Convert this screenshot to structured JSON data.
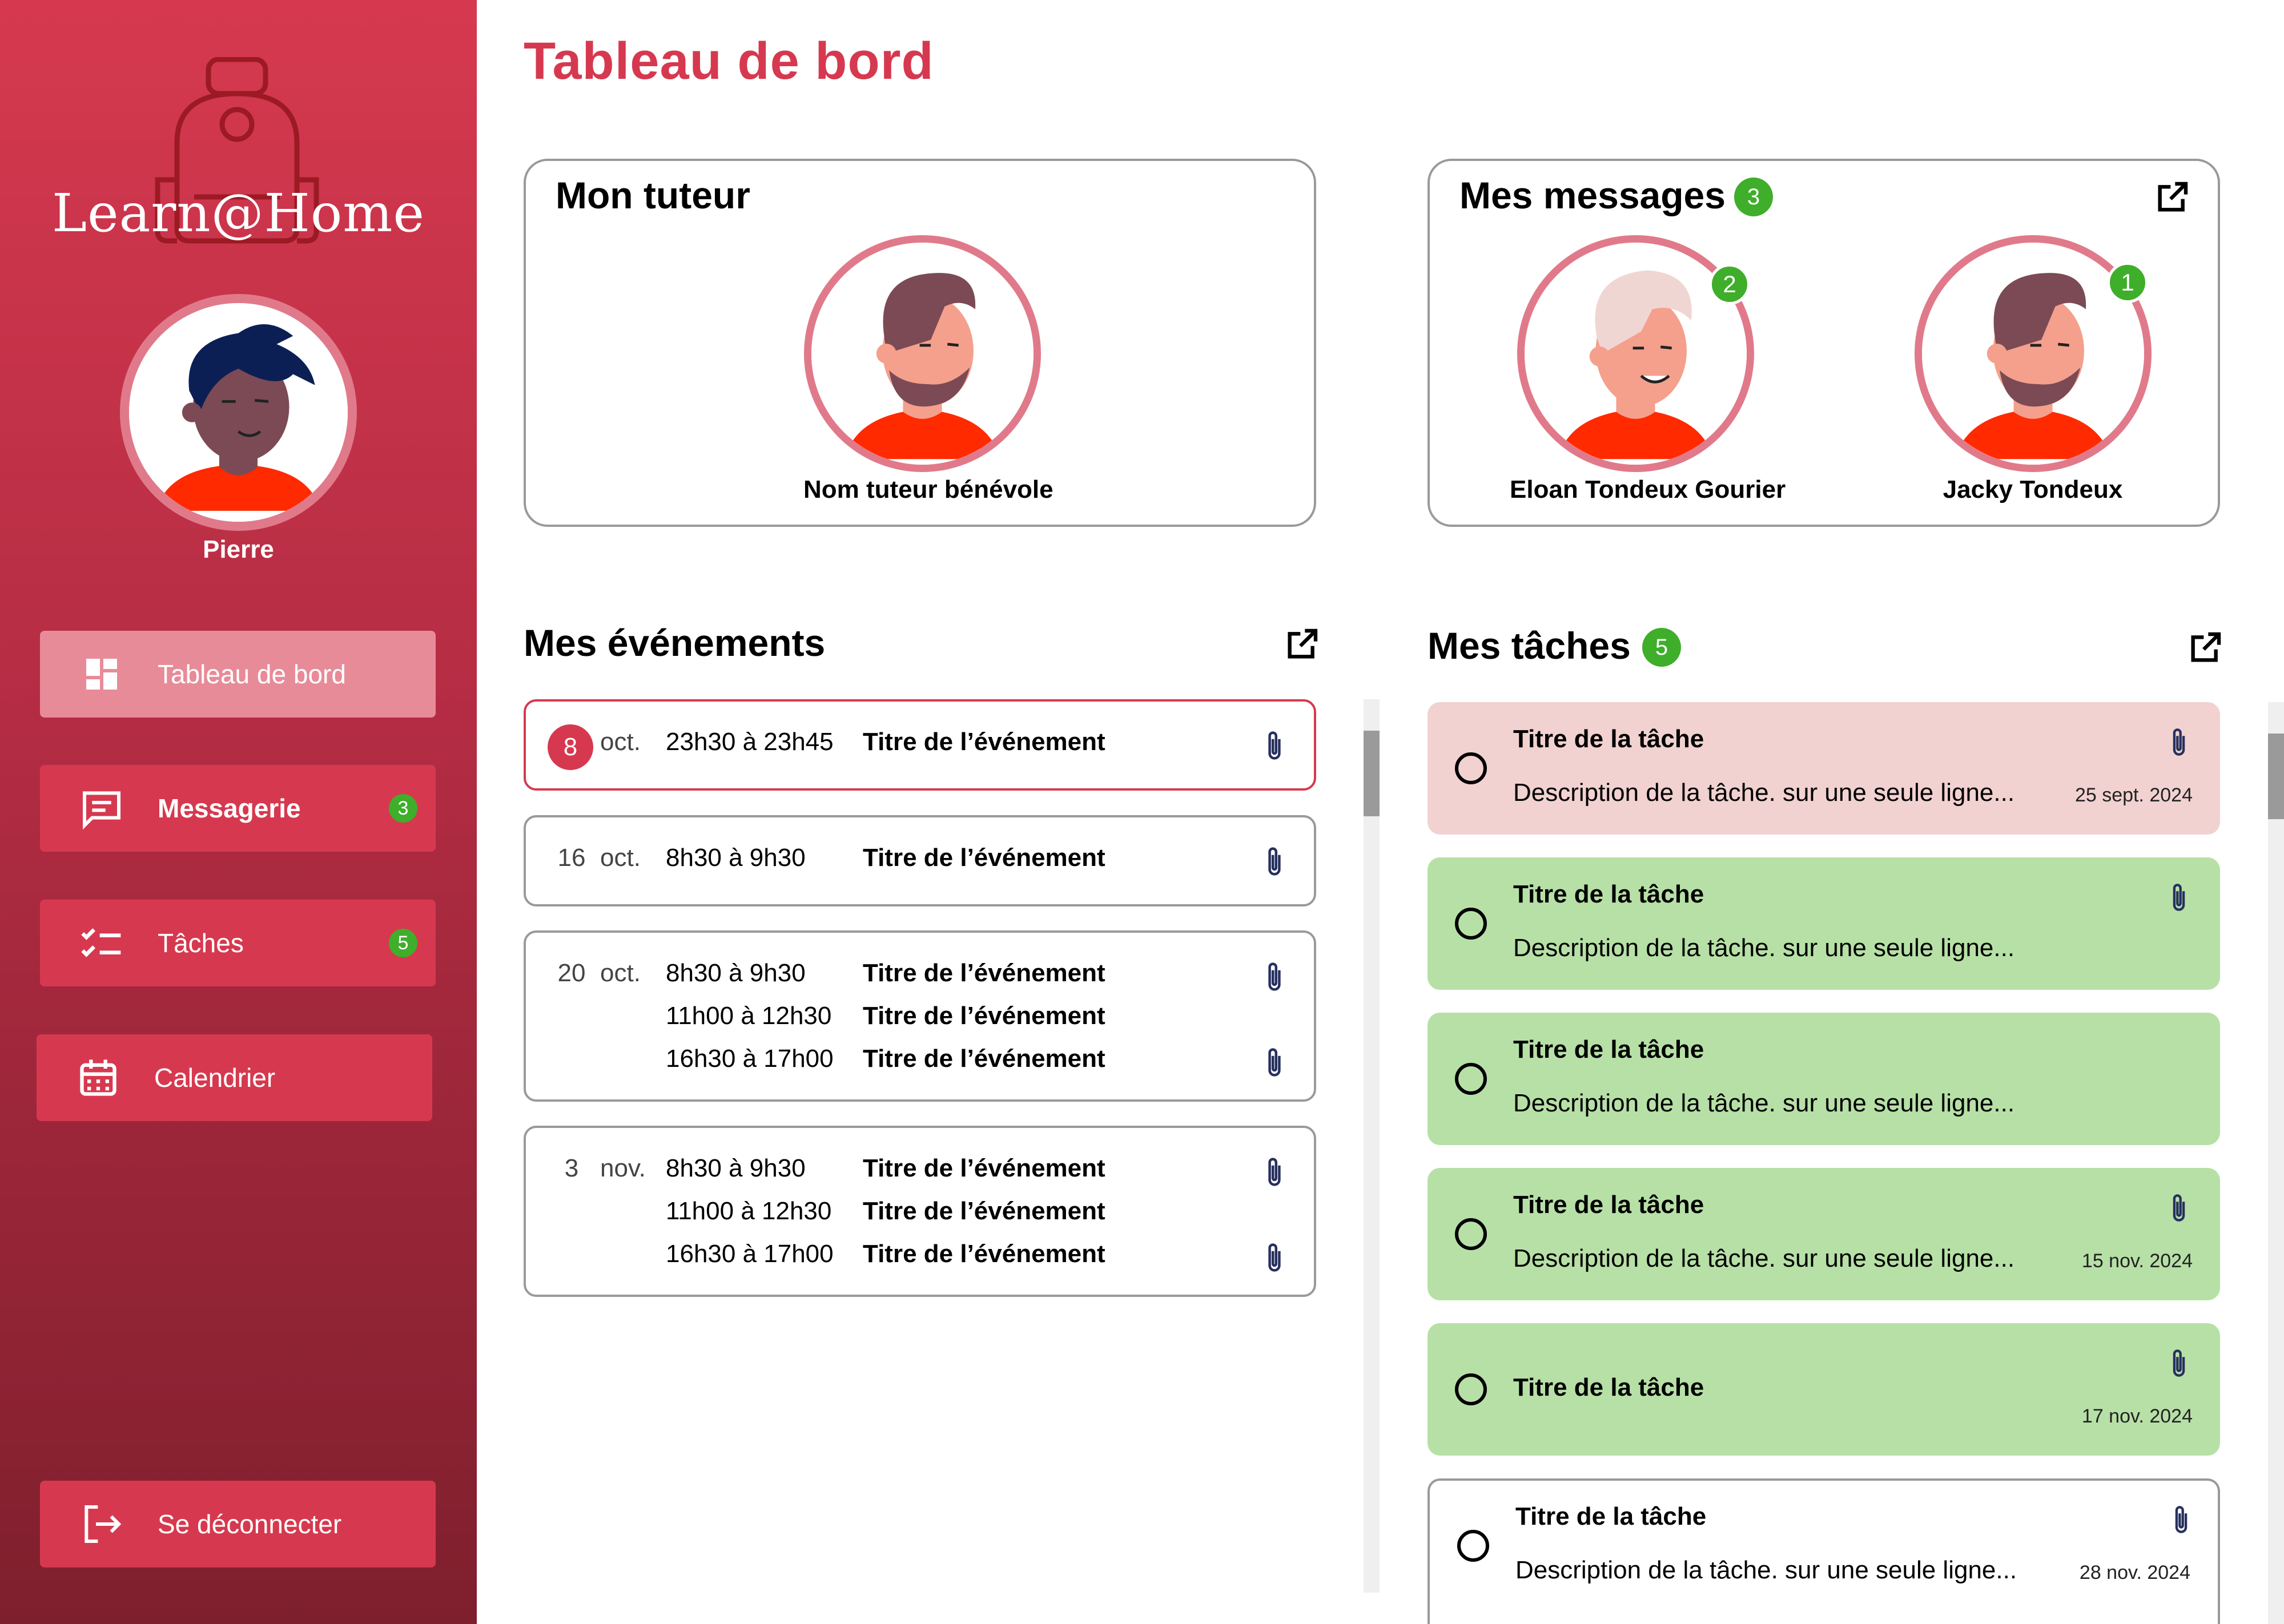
{
  "app": {
    "name": "Learn@Home"
  },
  "user": {
    "name": "Pierre"
  },
  "nav": [
    {
      "label": "Tableau de bord",
      "icon": "dashboard-icon",
      "active": true,
      "badge": ""
    },
    {
      "label": "Messagerie",
      "icon": "message-icon",
      "active": false,
      "badge": "3"
    },
    {
      "label": "Tâches",
      "icon": "task-list-icon",
      "active": false,
      "badge": "5"
    },
    {
      "label": "Calendrier",
      "icon": "calendar-icon",
      "active": false,
      "badge": ""
    }
  ],
  "logout": {
    "label": "Se déconnecter",
    "icon": "logout-icon"
  },
  "page": {
    "title": "Tableau de bord"
  },
  "tutor": {
    "title": "Mon tuteur",
    "name": "Nom tuteur bénévole"
  },
  "messages": {
    "title": "Mes messages",
    "count": "3",
    "contacts": [
      {
        "name": "Eloan Tondeux Gourier",
        "unread": "2"
      },
      {
        "name": "Jacky Tondeux",
        "unread": "1"
      }
    ]
  },
  "events": {
    "title": "Mes événements",
    "groups": [
      {
        "day": "8",
        "month": "oct.",
        "today": true,
        "items": [
          {
            "time": "23h30 à 23h45",
            "title": "Titre de l’événement",
            "attachment": true
          }
        ]
      },
      {
        "day": "16",
        "month": "oct.",
        "today": false,
        "items": [
          {
            "time": "8h30 à 9h30",
            "title": "Titre de l’événement",
            "attachment": true
          }
        ]
      },
      {
        "day": "20",
        "month": "oct.",
        "today": false,
        "items": [
          {
            "time": "8h30 à 9h30",
            "title": "Titre de l’événement",
            "attachment": true
          },
          {
            "time": "11h00 à 12h30",
            "title": "Titre de l’événement",
            "attachment": false
          },
          {
            "time": "16h30 à 17h00",
            "title": "Titre de l’événement",
            "attachment": true
          }
        ]
      },
      {
        "day": "3",
        "month": "nov.",
        "today": false,
        "items": [
          {
            "time": "8h30 à 9h30",
            "title": "Titre de l’événement",
            "attachment": true
          },
          {
            "time": "11h00 à 12h30",
            "title": "Titre de l’événement",
            "attachment": false
          },
          {
            "time": "16h30 à 17h00",
            "title": "Titre de l’événement",
            "attachment": true
          }
        ]
      }
    ]
  },
  "tasks": {
    "title": "Mes tâches",
    "count": "5",
    "items": [
      {
        "title": "Titre de la tâche",
        "description": "Description de la tâche. sur une seule ligne...",
        "date": "25 sept. 2024",
        "status": "late",
        "attachment": true
      },
      {
        "title": "Titre de la tâche",
        "description": "Description de la tâche. sur une seule ligne...",
        "date": "",
        "status": "ok",
        "attachment": true
      },
      {
        "title": "Titre de la tâche",
        "description": "Description de la tâche. sur une seule ligne...",
        "date": "",
        "status": "ok",
        "attachment": false
      },
      {
        "title": "Titre de la tâche",
        "description": "Description de la tâche. sur une seule ligne...",
        "date": "15  nov. 2024",
        "status": "ok",
        "attachment": true
      },
      {
        "title": "Titre de la tâche",
        "description": "",
        "date": "17  nov. 2024",
        "status": "ok",
        "attachment": true
      },
      {
        "title": "Titre de la tâche",
        "description": "Description de la tâche. sur une seule ligne...",
        "date": "28  nov. 2024",
        "status": "plain",
        "attachment": true
      }
    ]
  },
  "colors": {
    "brand": "#d6394f",
    "badge": "#3fae2a",
    "task_late": "#f1d2d0",
    "task_ok": "#b7e0a7"
  }
}
